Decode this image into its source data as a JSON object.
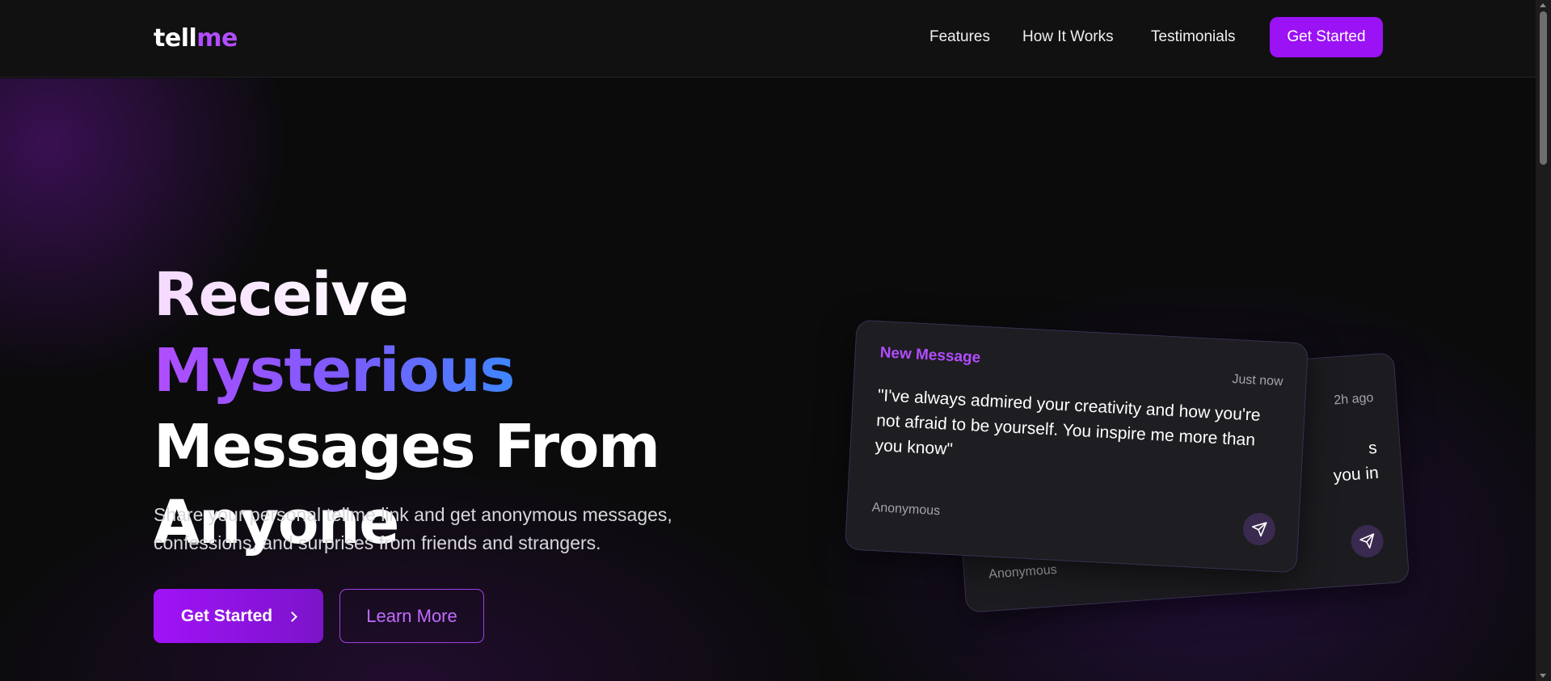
{
  "brand": {
    "part1": "tell",
    "part2": "me"
  },
  "nav": {
    "links": [
      "Features",
      "How It Works",
      "Testimonials"
    ],
    "cta_label": "Get Started"
  },
  "hero": {
    "headline_part1": "Receive ",
    "headline_accent": "Mysterious",
    "headline_line2": "Messages From",
    "headline_line3": "Anyone",
    "subtext": "Share your personal tellme link and get anonymous messages, confessions, and surprises from friends and strangers.",
    "primary_button": "Get Started",
    "secondary_button": "Learn More"
  },
  "cards": {
    "front": {
      "title": "New Message",
      "time": "Just now",
      "message": "\"I've always admired your creativity and how you're not afraid to be yourself. You inspire me more than you know\"",
      "sender": "Anonymous"
    },
    "back": {
      "time": "2h ago",
      "message_fragment_1": "s",
      "message_fragment_2": "you in",
      "sender": "Anonymous"
    }
  },
  "colors": {
    "accent": "#9b12f5",
    "accent_text": "#b14dff",
    "background": "#0b0b0c",
    "header": "#111112"
  },
  "icons": [
    "send-icon",
    "chevron-right-icon"
  ]
}
